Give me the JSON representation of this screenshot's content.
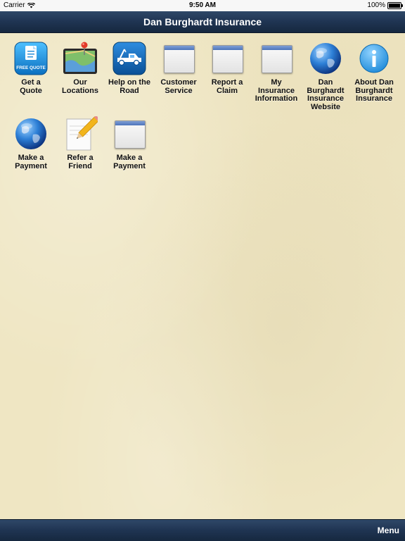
{
  "status_bar": {
    "carrier": "Carrier",
    "time": "9:50 AM",
    "battery": "100%"
  },
  "nav": {
    "title": "Dan Burghardt Insurance"
  },
  "tiles": [
    {
      "label": "Get a\nQuote",
      "icon": "free-quote-icon",
      "badge": "FREE QUOTE"
    },
    {
      "label": "Our\nLocations",
      "icon": "map-icon"
    },
    {
      "label": "Help on the\nRoad",
      "icon": "tow-truck-icon"
    },
    {
      "label": "Customer\nService",
      "icon": "window-icon"
    },
    {
      "label": "Report a\nClaim",
      "icon": "window-icon"
    },
    {
      "label": "My\nInsurance\nInformation",
      "icon": "window-icon"
    },
    {
      "label": "Dan\nBurghardt\nInsurance\nWebsite",
      "icon": "globe-icon"
    },
    {
      "label": "About Dan\nBurghardt\nInsurance",
      "icon": "info-icon"
    },
    {
      "label": "Make a\nPayment",
      "icon": "globe-icon"
    },
    {
      "label": "Refer a\nFriend",
      "icon": "pencil-note-icon"
    },
    {
      "label": "Make a\nPayment",
      "icon": "window-icon"
    }
  ],
  "bottom_bar": {
    "menu_label": "Menu"
  },
  "colors": {
    "nav_bar": "#1f3452",
    "background": "#efe6c3",
    "accent_blue": "#1a8ad8"
  }
}
